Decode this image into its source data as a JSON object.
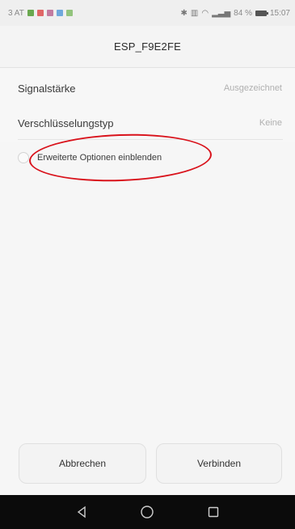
{
  "status_bar": {
    "carrier": "3 AT",
    "battery_percent": "84 %",
    "time": "15:07",
    "icon_names": [
      "sim-icon",
      "app-notification-icons",
      "bluetooth-icon",
      "vibrate-icon",
      "wifi-icon",
      "signal-icon",
      "battery-icon"
    ]
  },
  "title": "ESP_F9E2FE",
  "rows": [
    {
      "label": "Signalstärke",
      "value": "Ausgezeichnet"
    },
    {
      "label": "Verschlüsselungstyp",
      "value": "Keine"
    }
  ],
  "advanced_option": {
    "label": "Erweiterte Optionen einblenden",
    "checked": false
  },
  "buttons": {
    "cancel": "Abbrechen",
    "connect": "Verbinden"
  },
  "nav_icons": [
    "back-icon",
    "home-icon",
    "recents-icon"
  ],
  "colors": {
    "annotation": "#d9121b",
    "background": "#f6f6f6",
    "navbar": "#0b0b0b"
  }
}
